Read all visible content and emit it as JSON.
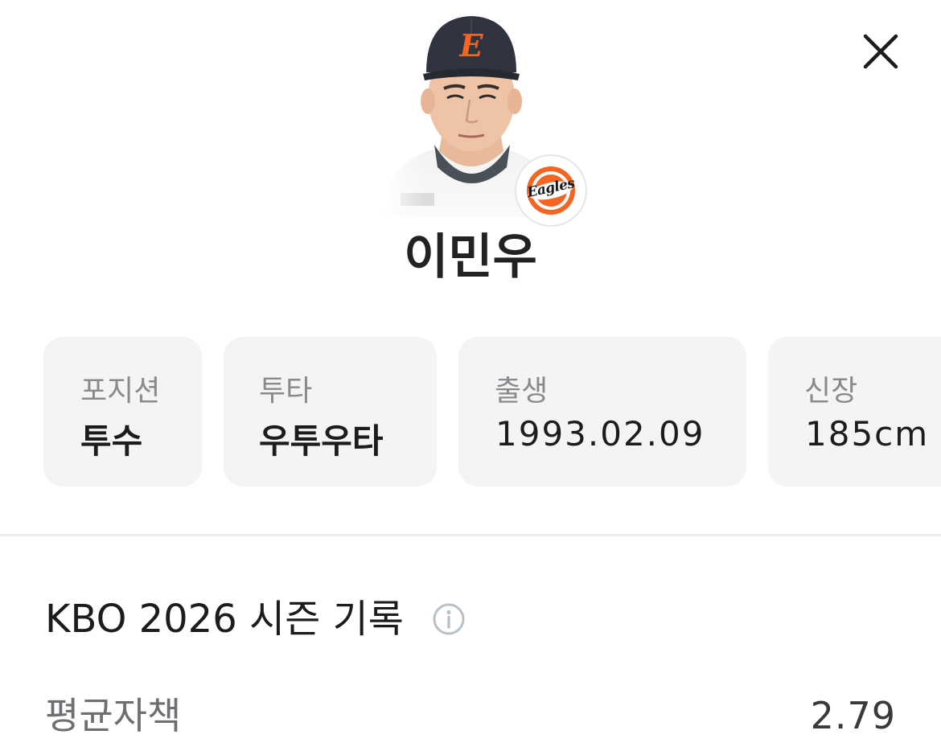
{
  "header": {
    "close_icon": "close-icon"
  },
  "player": {
    "name": "이민우",
    "photo_icon": "player-portrait",
    "team_badge_text": "Eagles",
    "team_color": "#f26522"
  },
  "info": [
    {
      "label": "포지션",
      "value": "투수"
    },
    {
      "label": "투타",
      "value": "우투우타"
    },
    {
      "label": "출생",
      "value": "1993.02.09"
    },
    {
      "label": "신장",
      "value": "185cm"
    }
  ],
  "season": {
    "title": "KBO 2026 시즌 기록",
    "info_icon": "info-icon",
    "stats": [
      {
        "label": "평균자책",
        "value": "2.79"
      }
    ]
  }
}
